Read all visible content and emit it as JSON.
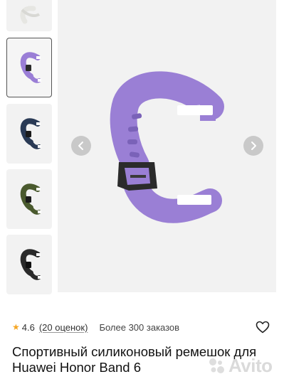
{
  "gallery": {
    "thumbnails": [
      {
        "variant": "white",
        "color": "#e9e9e5",
        "selected": false
      },
      {
        "variant": "purple",
        "color": "#9a7ed6",
        "selected": true
      },
      {
        "variant": "navy",
        "color": "#2a3a55",
        "selected": false
      },
      {
        "variant": "army-green",
        "color": "#4a5a2e",
        "selected": false
      },
      {
        "variant": "black",
        "color": "#2a2a2a",
        "selected": false
      }
    ],
    "main_strap_color": "#9a7fd5",
    "buckle_color": "#2b2b2b",
    "prev_icon": "chevron-left-icon",
    "next_icon": "chevron-right-icon"
  },
  "product": {
    "rating": "4.6",
    "reviews": "(20 оценок)",
    "orders": "Более 300 заказов",
    "title": "Спортивный силиконовый ремешок для Huawei Honor Band 6",
    "favorite_icon": "heart-outline-icon"
  },
  "watermark": {
    "text": "Avito"
  }
}
